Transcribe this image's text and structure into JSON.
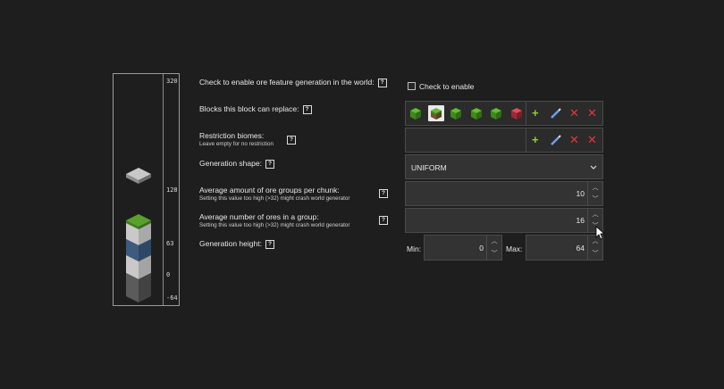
{
  "preview": {
    "ticks": [
      "320",
      "128",
      "63",
      "0",
      "-64"
    ]
  },
  "labels": {
    "enable": "Check to enable ore feature generation in the world:",
    "replace": "Blocks this block can replace:",
    "biomes": "Restriction biomes:",
    "biomes_sub": "Leave empty for no restriction",
    "shape": "Generation shape:",
    "groups": "Average amount of ore groups per chunk:",
    "groups_sub": "Setting this value too high (>32) might crash world generator",
    "ores": "Average number of ores in a group:",
    "ores_sub": "Setting this value too high (>32) might crash world generator",
    "height": "Generation height:",
    "help": "?"
  },
  "enable_checkbox": {
    "label": "Check to enable"
  },
  "shape_select": {
    "value": "UNIFORM"
  },
  "groups_value": "10",
  "ores_value": "16",
  "height_min_label": "Min:",
  "height_min_value": "0",
  "height_max_label": "Max:",
  "height_max_value": "64",
  "replace_blocks": [
    {
      "icon": "grass-block-icon"
    },
    {
      "icon": "grass-block-icon",
      "selected": true
    },
    {
      "icon": "grass-block-icon"
    },
    {
      "icon": "grass-block-icon"
    },
    {
      "icon": "grass-block-icon"
    },
    {
      "icon": "red-block-icon"
    }
  ],
  "colors": {
    "background": "#1e1e1e",
    "field": "#333333",
    "add": "#8fd03a",
    "remove": "#e0383a",
    "edit": "#5b8ee6"
  }
}
